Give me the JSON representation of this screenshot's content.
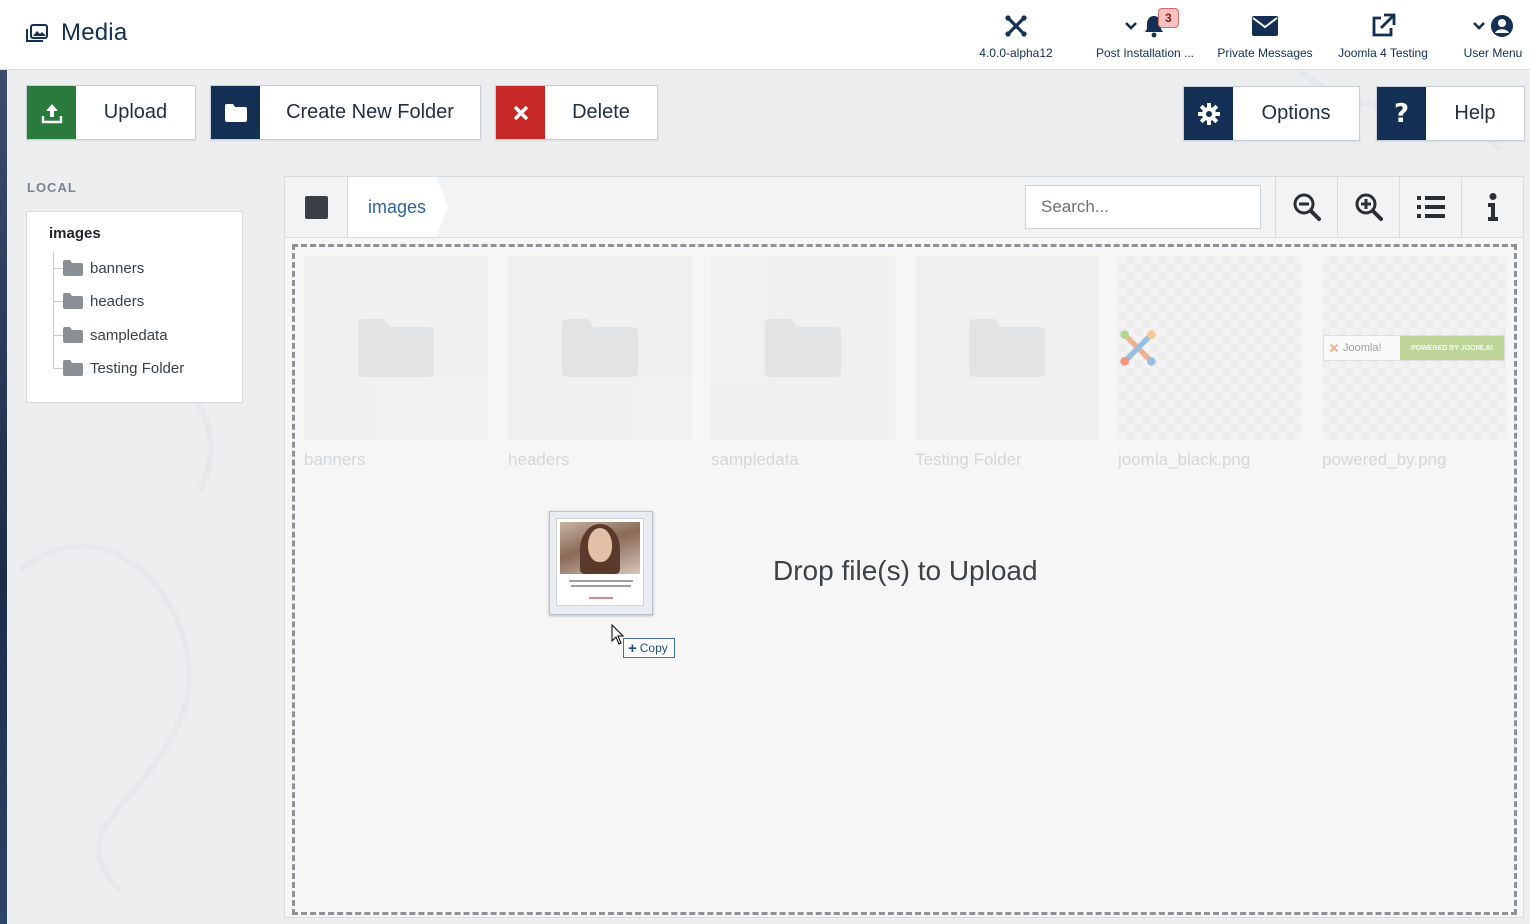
{
  "header": {
    "title": "Media",
    "items": [
      {
        "label": "4.0.0-alpha12",
        "icon": "joomla-icon"
      },
      {
        "label": "Post Installation ...",
        "icon": "bell-icon",
        "badge": "3"
      },
      {
        "label": "Private Messages",
        "icon": "envelope-icon"
      },
      {
        "label": "Joomla 4 Testing",
        "icon": "external-link-icon"
      },
      {
        "label": "User Menu",
        "icon": "user-circle-icon"
      }
    ]
  },
  "toolbar": {
    "upload_label": "Upload",
    "new_folder_label": "Create New Folder",
    "delete_label": "Delete",
    "options_label": "Options",
    "help_label": "Help"
  },
  "sidebar": {
    "heading": "LOCAL",
    "root": "images",
    "folders": [
      "banners",
      "headers",
      "sampledata",
      "Testing Folder"
    ]
  },
  "browser": {
    "breadcrumb": "images",
    "search_placeholder": "Search...",
    "items": [
      {
        "name": "banners",
        "type": "folder"
      },
      {
        "name": "headers",
        "type": "folder"
      },
      {
        "name": "sampledata",
        "type": "folder"
      },
      {
        "name": "Testing Folder",
        "type": "folder"
      },
      {
        "name": "joomla_black.png",
        "type": "image"
      },
      {
        "name": "powered_by.png",
        "type": "image"
      }
    ],
    "drop_text": "Drop file(s) to Upload",
    "powered_by_text": "POWERED BY JOOMLA!",
    "joomla_wordmark": "Joomla!"
  },
  "drag": {
    "tooltip": "Copy"
  },
  "colors": {
    "brand_navy": "#132f53",
    "upload_green": "#2a7a3b",
    "delete_red": "#c52827",
    "link_blue": "#2b63a6"
  }
}
